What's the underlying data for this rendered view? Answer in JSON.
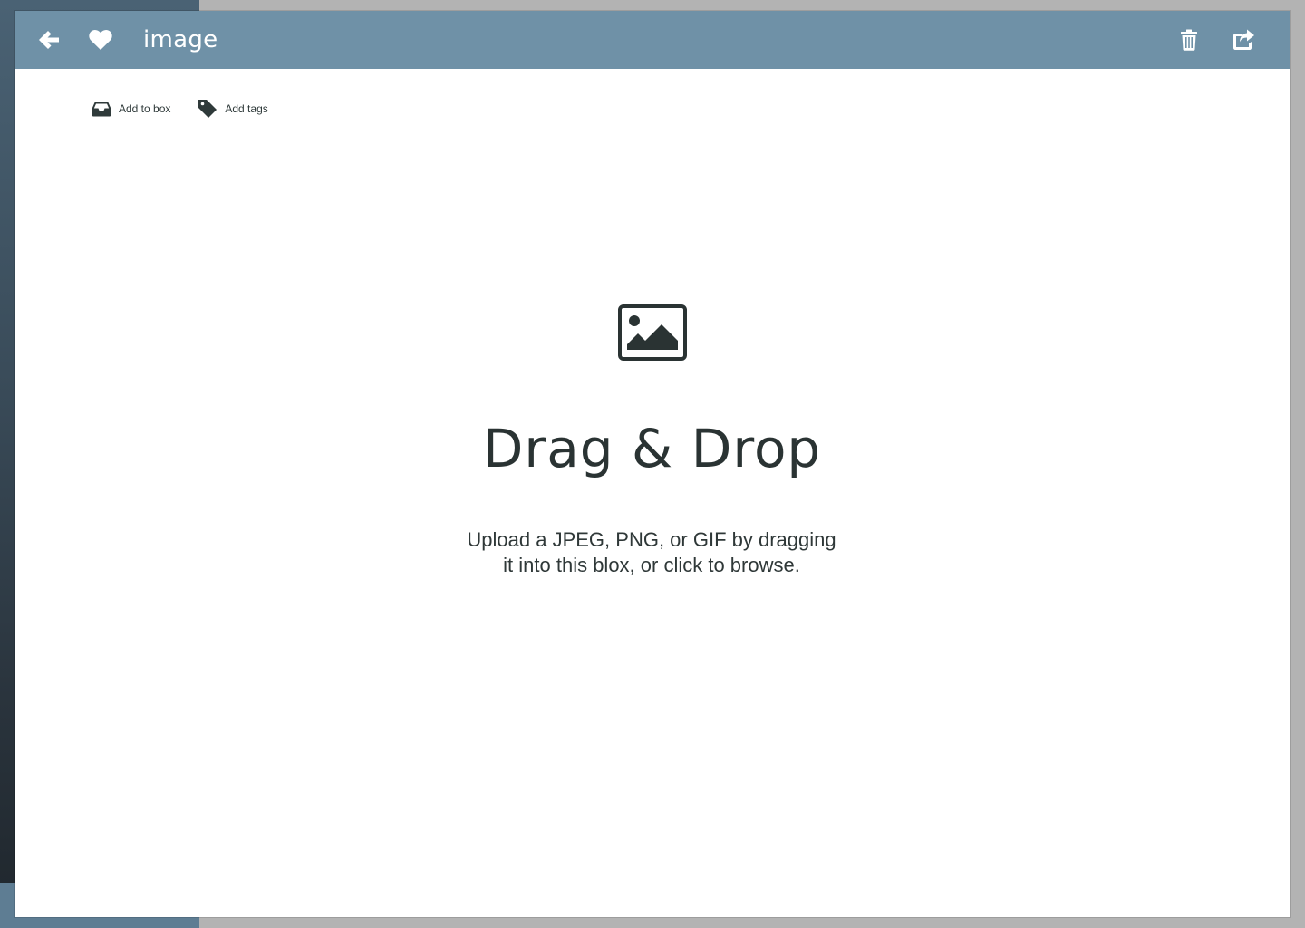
{
  "header": {
    "title": "image",
    "back_icon": "arrow-left-icon",
    "favorite_icon": "heart-icon",
    "trash_icon": "trash-icon",
    "share_icon": "share-icon",
    "background_color": "#6f91a7"
  },
  "actions": [
    {
      "label": "Add to box",
      "icon": "inbox-icon"
    },
    {
      "label": "Add tags",
      "icon": "tag-icon"
    }
  ],
  "dropzone": {
    "icon": "image-icon",
    "heading": "Drag & Drop",
    "line1": "Upload a JPEG, PNG, or GIF by dragging",
    "line2": "it into this blox, or click to browse."
  }
}
